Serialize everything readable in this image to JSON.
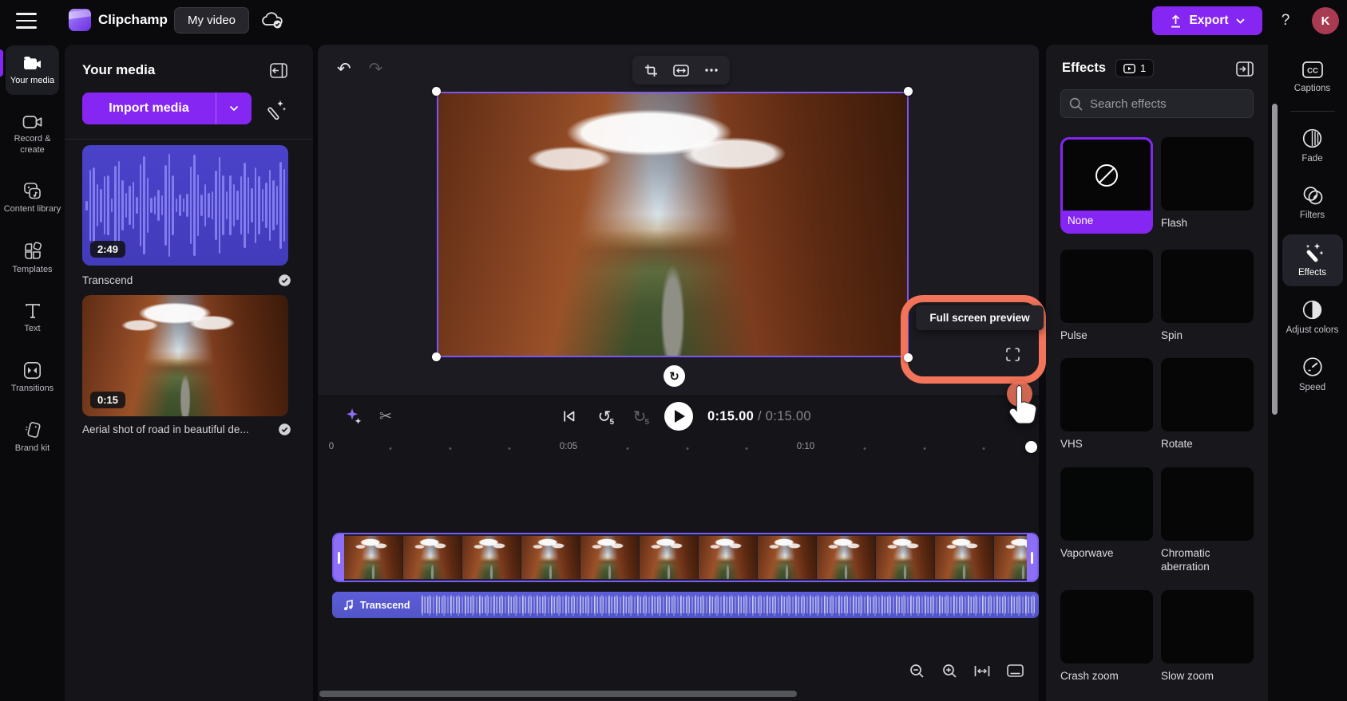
{
  "topbar": {
    "app_name": "Clipchamp",
    "project_title": "My video",
    "export_label": "Export",
    "help_label": "?",
    "avatar_initial": "K"
  },
  "sidebar": {
    "items": [
      {
        "label": "Your media",
        "active": true
      },
      {
        "label": "Record & create"
      },
      {
        "label": "Content library"
      },
      {
        "label": "Templates"
      },
      {
        "label": "Text"
      },
      {
        "label": "Transitions"
      },
      {
        "label": "Brand kit"
      }
    ]
  },
  "media_panel": {
    "title": "Your media",
    "import_label": "Import media",
    "items": [
      {
        "name": "Transcend",
        "duration": "2:49",
        "type": "audio"
      },
      {
        "name": "Aerial shot of road in beautiful de...",
        "duration": "0:15",
        "type": "video"
      }
    ]
  },
  "preview": {
    "current_time": "0:15.00",
    "time_separator": "/",
    "total_time": "0:15.00",
    "skip_back_label": "5",
    "skip_forward_label": "5",
    "tooltip": "Full screen preview"
  },
  "timeline": {
    "ruler_labels": [
      "0",
      "0:05",
      "0:10"
    ],
    "audio_track_name": "Transcend"
  },
  "effects_panel": {
    "title": "Effects",
    "badge_count": "1",
    "search_placeholder": "Search effects",
    "items": [
      {
        "label": "None",
        "kind": "none",
        "selected": true
      },
      {
        "label": "Flash",
        "kind": "black"
      },
      {
        "label": "Pulse",
        "kind": "canyon"
      },
      {
        "label": "Spin",
        "kind": "canyon"
      },
      {
        "label": "VHS",
        "kind": "canyon"
      },
      {
        "label": "Rotate",
        "kind": "canyon"
      },
      {
        "label": "Vaporwave",
        "kind": "vaporwave"
      },
      {
        "label": "Chromatic aberration",
        "kind": "canyon"
      },
      {
        "label": "Crash zoom",
        "kind": "canyon"
      },
      {
        "label": "Slow zoom",
        "kind": "canyon"
      }
    ]
  },
  "right_toolbar": {
    "items": [
      {
        "label": "Captions"
      },
      {
        "label": "Fade"
      },
      {
        "label": "Filters"
      },
      {
        "label": "Effects",
        "active": true
      },
      {
        "label": "Adjust colors"
      },
      {
        "label": "Speed"
      }
    ]
  },
  "colors": {
    "accent_purple": "#8526f2",
    "highlight_orange": "#f2745a",
    "audio_track": "#5b5cd8",
    "avatar": "#a83a52",
    "selection_border": "#7e57f2"
  }
}
